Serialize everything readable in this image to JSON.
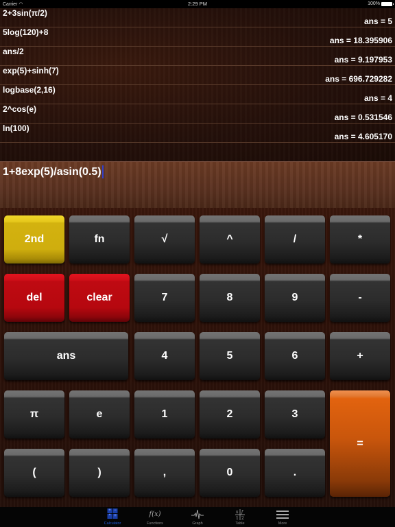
{
  "status_bar": {
    "carrier": "Carrier",
    "wifi_icon": "wifi-icon",
    "time": "2:29 PM",
    "battery": "100%"
  },
  "history": [
    {
      "expression": "2+3sin(π/2)",
      "result": "ans = 5"
    },
    {
      "expression": "5log(120)+8",
      "result": "ans = 18.395906"
    },
    {
      "expression": "ans/2",
      "result": "ans = 9.197953"
    },
    {
      "expression": "exp(5)+sinh(7)",
      "result": "ans = 696.729282"
    },
    {
      "expression": "logbase(2,16)",
      "result": "ans = 4"
    },
    {
      "expression": "2^cos(e)",
      "result": "ans = 0.531546"
    },
    {
      "expression": "ln(100)",
      "result": "ans = 4.605170"
    }
  ],
  "input": {
    "value": "1+8exp(5)/asin(0.5)"
  },
  "keys": {
    "second": "2nd",
    "fn": "fn",
    "sqrt": "√",
    "power": "^",
    "divide": "/",
    "multiply": "*",
    "del": "del",
    "clear": "clear",
    "seven": "7",
    "eight": "8",
    "nine": "9",
    "minus": "-",
    "ans": "ans",
    "four": "4",
    "five": "5",
    "six": "6",
    "plus": "+",
    "pi": "π",
    "e": "e",
    "one": "1",
    "two": "2",
    "three": "3",
    "equals": "=",
    "lparen": "(",
    "rparen": ")",
    "comma": ",",
    "zero": "0",
    "dot": "."
  },
  "tabs": [
    {
      "label": "Calculator",
      "icon": "calculator-icon",
      "active": true
    },
    {
      "label": "Functions",
      "icon": "function-icon",
      "glyph": "f(x)"
    },
    {
      "label": "Graph",
      "icon": "graph-icon"
    },
    {
      "label": "Table",
      "icon": "table-icon"
    },
    {
      "label": "More",
      "icon": "menu-icon"
    }
  ],
  "colors": {
    "accent": "#1e5ad8",
    "yellow_key": "#d3b20f",
    "red_key": "#bf0a12",
    "orange_key": "#e2630f",
    "cursor": "#3340c8"
  }
}
